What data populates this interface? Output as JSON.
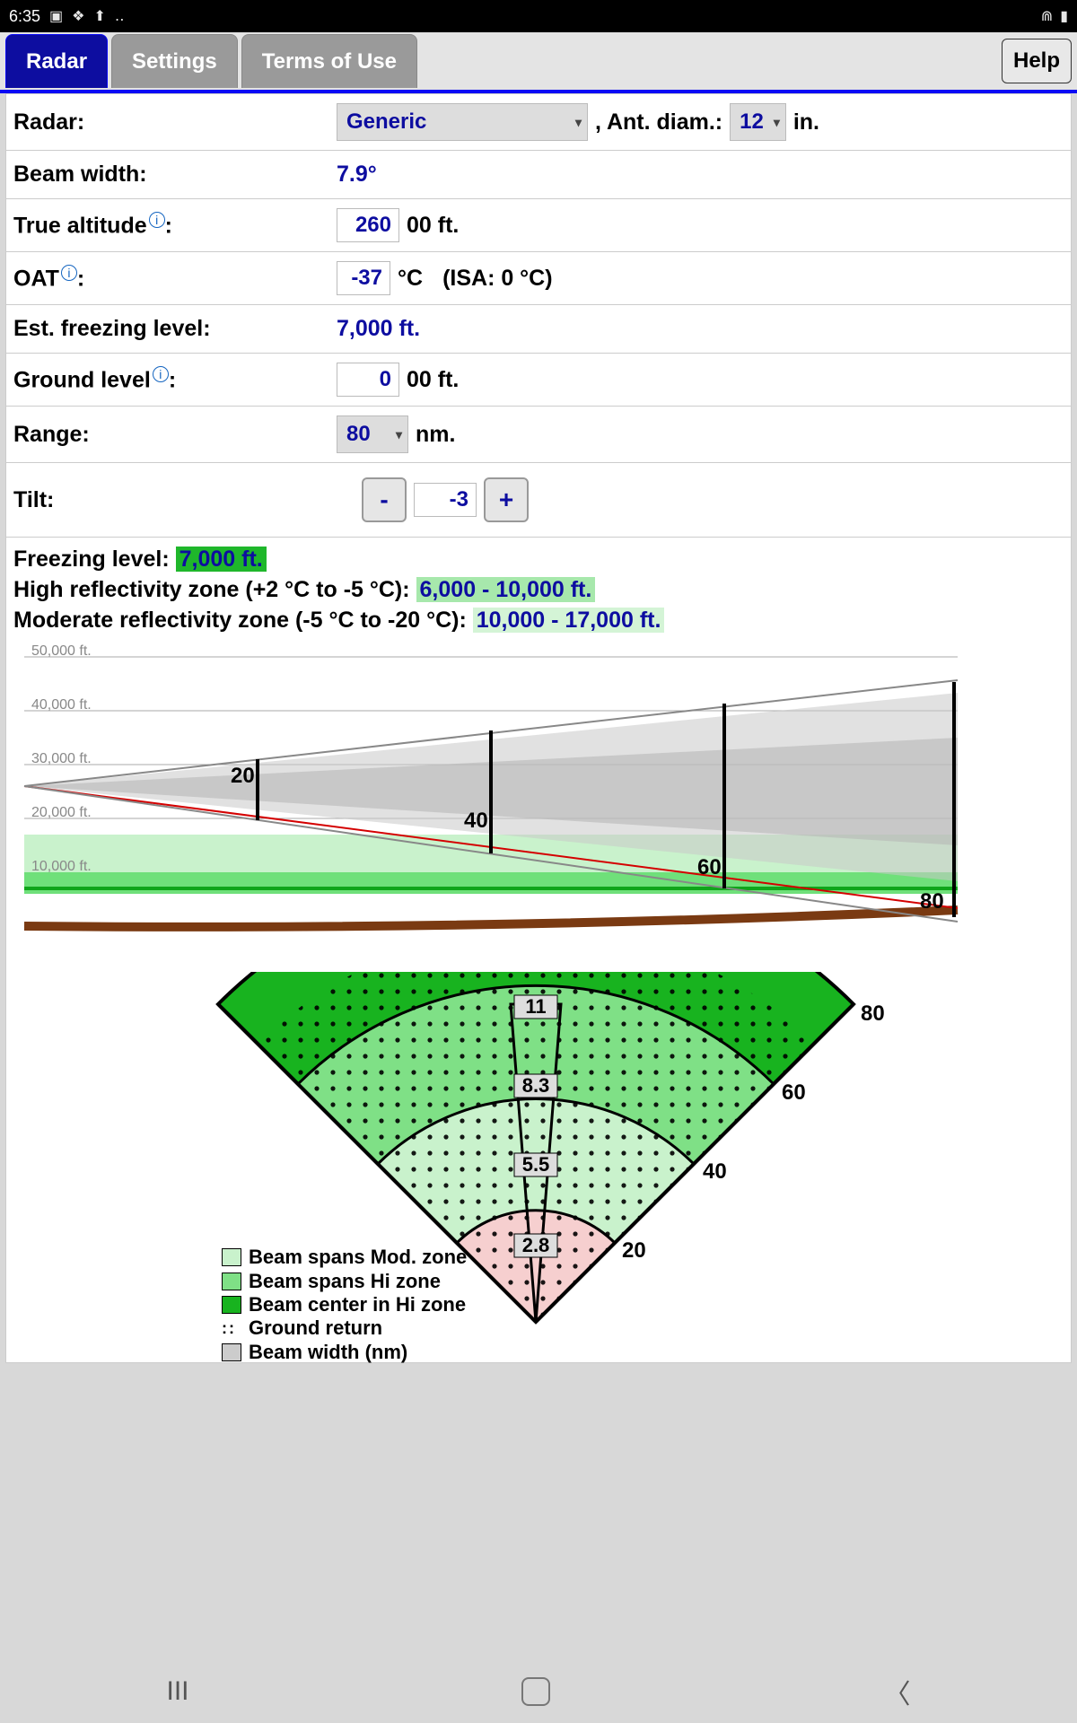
{
  "statusbar": {
    "time": "6:35"
  },
  "tabs": {
    "radar": "Radar",
    "settings": "Settings",
    "terms": "Terms of Use",
    "help": "Help"
  },
  "labels": {
    "radar": "Radar:",
    "antdiam": ", Ant. diam.:",
    "in": "in.",
    "beamwidth": "Beam width:",
    "truealt": "True altitude",
    "oat": "OAT",
    "estfreeze": "Est. freezing level:",
    "groundlevel": "Ground level",
    "range": "Range:",
    "tilt": "Tilt:",
    "suffix00ft": "00 ft.",
    "nm": "nm.",
    "degC": "°C",
    "colon": ":"
  },
  "values": {
    "radarName": "Generic",
    "antDiam": "12",
    "beamWidth": "7.9°",
    "trueAlt": "260",
    "oat": "-37",
    "isaNote": "(ISA: 0 °C)",
    "estFreeze": "7,000 ft.",
    "groundLevel": "0",
    "range": "80",
    "tilt": "-3"
  },
  "info": {
    "freezeLabel": "Freezing level: ",
    "freezeVal": "7,000 ft.",
    "hiReflLabel": "High reflectivity zone (+2 °C to -5 °C): ",
    "hiReflVal": "6,000 - 10,000 ft.",
    "modReflLabel": "Moderate reflectivity zone (-5 °C to -20 °C): ",
    "modReflVal": "10,000 - 17,000 ft."
  },
  "chart_data": [
    {
      "type": "profile",
      "title": "Beam altitude vs range side view",
      "x_unit": "nm",
      "y_unit": "ft",
      "x_range": [
        0,
        80
      ],
      "y_range": [
        0,
        50000
      ],
      "y_ticks_ft": [
        10000,
        20000,
        30000,
        40000,
        50000
      ],
      "range_markers_nm": [
        20,
        40,
        60,
        80
      ],
      "aircraft_altitude_ft": 26000,
      "ground_level_ft": 0,
      "beam_tilt_deg": -3,
      "beam_width_deg": 7.9,
      "freezing_level_ft": 7000,
      "high_reflectivity_band_ft": [
        6000,
        10000
      ],
      "moderate_reflectivity_band_ft": [
        10000,
        17000
      ],
      "beam_center_altitude_ft": [
        {
          "range_nm": 0,
          "alt_ft": 26000
        },
        {
          "range_nm": 20,
          "alt_ft": 19600
        },
        {
          "range_nm": 40,
          "alt_ft": 13300
        },
        {
          "range_nm": 60,
          "alt_ft": 7000
        },
        {
          "range_nm": 80,
          "alt_ft": 800
        }
      ]
    },
    {
      "type": "plan-sector",
      "title": "Beam plan view / ground return sector",
      "range_rings_nm": [
        20,
        40,
        60,
        80
      ],
      "beam_width_nm_at_ring": {
        "20": 2.8,
        "40": 5.5,
        "60": 8.3,
        "80": 11
      },
      "zones": {
        "beam_spans_mod_zone_nm": [
          40,
          80
        ],
        "beam_spans_hi_zone_nm": [
          40,
          80
        ],
        "beam_center_in_hi_zone_nm": [
          52,
          68
        ],
        "ground_return_nm": [
          30,
          80
        ]
      },
      "legend": [
        "Beam spans Mod. zone",
        "Beam spans Hi zone",
        "Beam center in Hi zone",
        "Ground return",
        "Beam width (nm)"
      ]
    }
  ],
  "legend": {
    "mod": "Beam spans Mod. zone",
    "hi": "Beam spans Hi zone",
    "center": "Beam center in Hi zone",
    "ground": "Ground return",
    "bw": "Beam width (nm)"
  },
  "plan_labels": {
    "r20": "20",
    "r40": "40",
    "r60": "60",
    "r80": "80",
    "b1": "2.8",
    "b2": "5.5",
    "b3": "8.3",
    "b4": "11"
  },
  "profile_labels": {
    "y50": "50,000 ft.",
    "y40": "40,000 ft.",
    "y30": "30,000 ft.",
    "y20": "20,000 ft.",
    "y10": "10,000 ft.",
    "r20": "20",
    "r40": "40",
    "r60": "60",
    "r80": "80"
  }
}
